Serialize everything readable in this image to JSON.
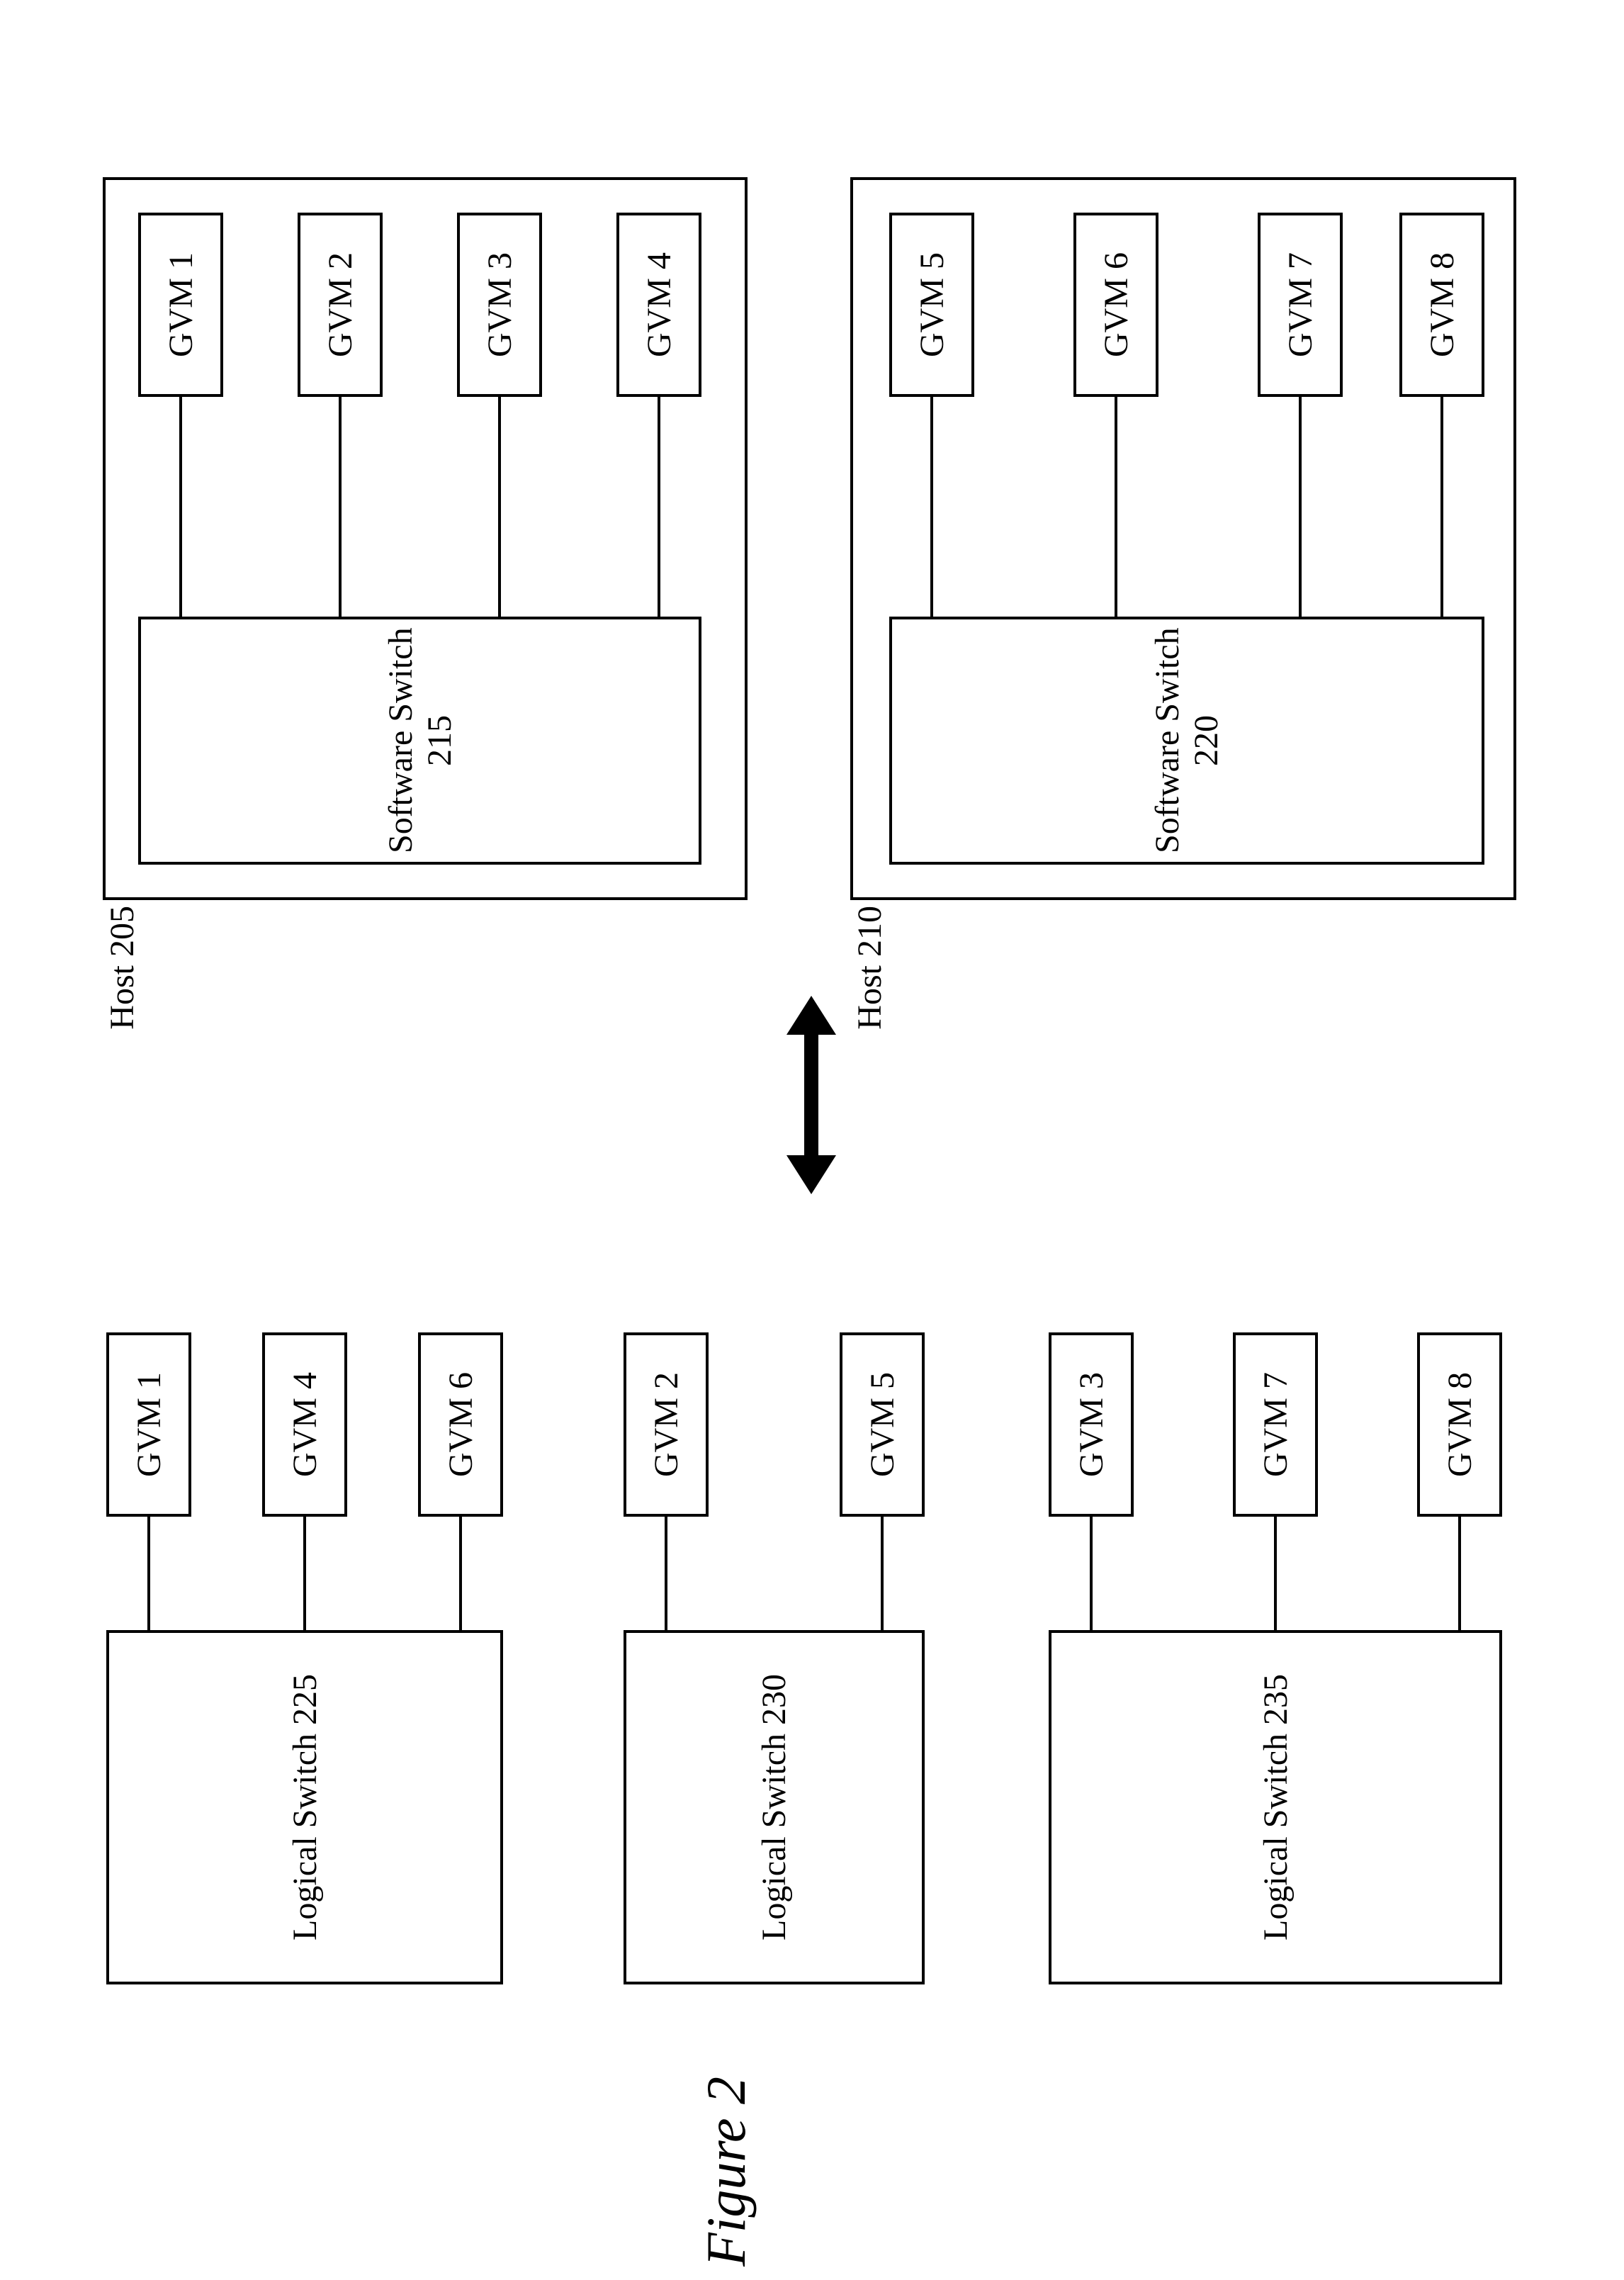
{
  "hosts": [
    {
      "label": "Host 205",
      "switch": "Software Switch 215",
      "vms": [
        "GVM 1",
        "GVM 2",
        "GVM 3",
        "GVM 4"
      ]
    },
    {
      "label": "Host 210",
      "switch": "Software Switch 220",
      "vms": [
        "GVM 5",
        "GVM 6",
        "GVM 7",
        "GVM 8"
      ]
    }
  ],
  "logical": [
    {
      "switch": "Logical Switch 225",
      "vms": [
        "GVM 1",
        "GVM 4",
        "GVM 6"
      ]
    },
    {
      "switch": "Logical Switch 230",
      "vms": [
        "GVM 2",
        "GVM 5"
      ]
    },
    {
      "switch": "Logical Switch 235",
      "vms": [
        "GVM 3",
        "GVM 7",
        "GVM 8"
      ]
    }
  ],
  "figure_caption": "Figure 2"
}
